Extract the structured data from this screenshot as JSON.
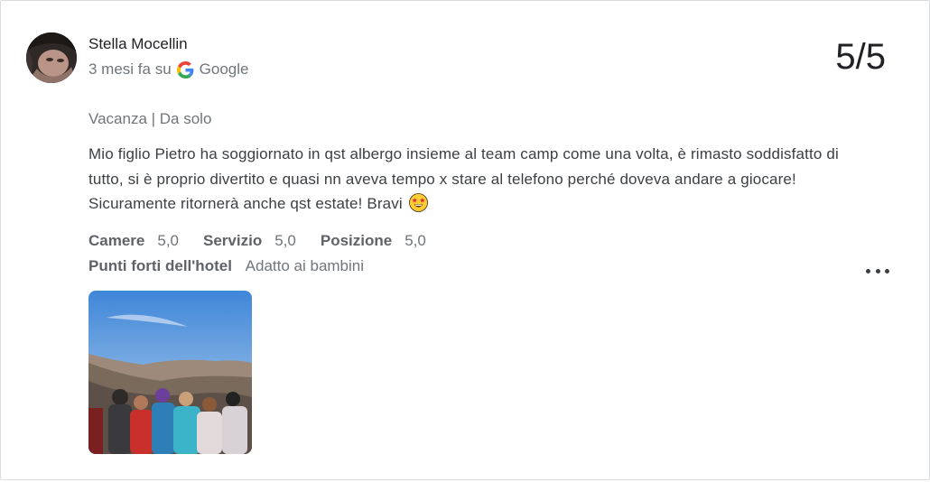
{
  "review": {
    "author_name": "Stella Mocellin",
    "time_ago": "3 mesi fa su",
    "source": "Google",
    "score": "5/5",
    "trip_type": "Vacanza | Da solo",
    "text": "Mio figlio Pietro ha soggiornato in qst albergo insieme al team camp come una volta, è rimasto soddisfatto di tutto, si è proprio divertito e quasi nn aveva tempo x stare al telefono perché doveva andare a giocare! Sicuramente ritornerà anche qst estate! Bravi",
    "emoji_icon": "star-struck-emoji-icon",
    "ratings": [
      {
        "label": "Camere",
        "value": "5,0"
      },
      {
        "label": "Servizio",
        "value": "5,0"
      },
      {
        "label": "Posizione",
        "value": "5,0"
      }
    ],
    "highlights_label": "Punti forti dell'hotel",
    "highlights_value": "Adatto ai bambini",
    "more_icon": "more-horizontal-icon"
  },
  "colors": {
    "title": "#202124",
    "secondary": "#70757a",
    "body": "#3c4043",
    "border": "#dadce0"
  }
}
